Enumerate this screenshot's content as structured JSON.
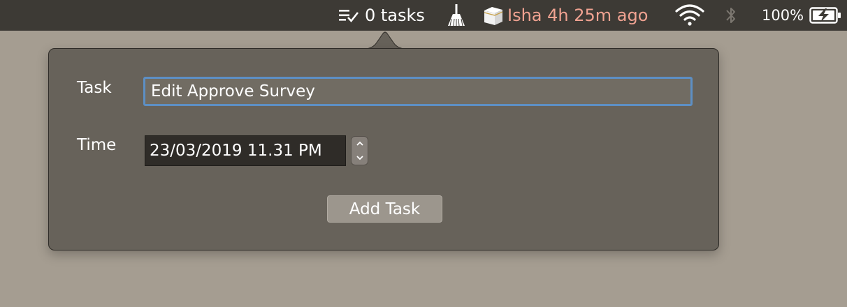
{
  "menubar": {
    "tasks": {
      "icon": "task-list-check-icon",
      "label": "0 tasks"
    },
    "broom": {
      "icon": "broom-icon"
    },
    "prayer": {
      "icon": "kaaba-icon",
      "label": "Isha 4h 25m ago",
      "color": "#f0a291"
    },
    "wifi": {
      "icon": "wifi-icon"
    },
    "bluetooth": {
      "icon": "bluetooth-icon",
      "enabled": false
    },
    "battery": {
      "icon": "battery-charging-icon",
      "label": "100%"
    }
  },
  "popover": {
    "task_label": "Task",
    "task_value": "Edit Approve Survey",
    "time_label": "Time",
    "time_value": "23/03/2019 11.31 PM",
    "stepper_up_icon": "chevron-up-icon",
    "stepper_down_icon": "chevron-down-icon",
    "add_button_label": "Add Task"
  },
  "colors": {
    "menubar_bg": "#3d3a35",
    "popover_bg": "#67625a",
    "focus_ring": "#5d8fc4",
    "desktop_bg": "#a59d91"
  }
}
